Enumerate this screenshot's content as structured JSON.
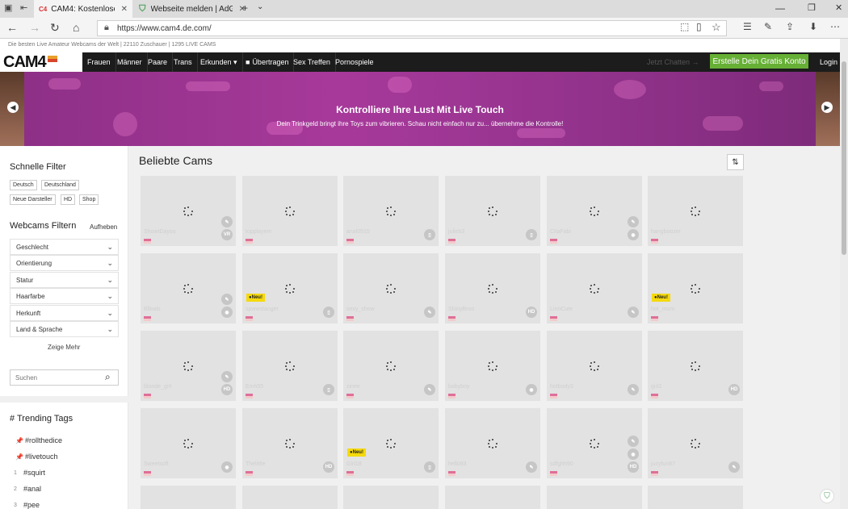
{
  "browser": {
    "tabs": [
      {
        "label": "CAM4: Kostenlose Live S",
        "favicon": "C4"
      },
      {
        "label": "Webseite melden | AdGuard",
        "favicon": "shield"
      }
    ],
    "url": "https://www.cam4.de.com/"
  },
  "site": {
    "topline": "Die besten Live Amateur Webcams der Welt  | 22110  Zuschauer  | 1295  LIVE CAMS",
    "logo": "CAM4",
    "menu": [
      "Frauen",
      "Männer",
      "Paare",
      "Trans",
      "Erkunden ▾",
      "Übertragen",
      "Sex Treffen",
      "Pornospiele"
    ],
    "jetzt": "Jetzt Chatten →",
    "signup": "Erstelle Dein Gratis Konto",
    "login": "Login"
  },
  "banner": {
    "title": "Kontrolliere Ihre Lust Mit Live Touch",
    "subtitle": "Dein Trinkgeld bringt ihre Toys zum vibrieren. Schau nicht einfach nur zu... übernehme die Kontrolle!"
  },
  "sidebar": {
    "quick_title": "Schnelle Filter",
    "chips": [
      "Deutsch",
      "Deutschland",
      "Neue Darsteller",
      "HD",
      "Shop"
    ],
    "filter_title": "Webcams Filtern",
    "clear": "Aufheben",
    "filters": [
      "Geschlecht",
      "Orientierung",
      "Statur",
      "Haarfarbe",
      "Herkunft",
      "Land & Sprache"
    ],
    "more": "Zeige Mehr",
    "search_placeholder": "Suchen",
    "trending_title": "# Trending Tags",
    "tags": [
      {
        "marker": "📌",
        "label": "#rollthedice"
      },
      {
        "marker": "📌",
        "label": "#livetouch"
      },
      {
        "marker": "1",
        "label": "#squirt"
      },
      {
        "marker": "2",
        "label": "#anal"
      },
      {
        "marker": "3",
        "label": "#pee"
      }
    ]
  },
  "main": {
    "title": "Beliebte Cams",
    "neu_label": "●Neu!",
    "cards": [
      {
        "name": "ShowtDayou",
        "badges": [
          "✎",
          "VR"
        ],
        "neu": false
      },
      {
        "name": "topplayern",
        "badges": [],
        "neu": false
      },
      {
        "name": "anal0515",
        "badges": [
          "▯"
        ],
        "neu": false
      },
      {
        "name": "julieb3",
        "badges": [
          "▯"
        ],
        "neu": false
      },
      {
        "name": "CitaFabi",
        "badges": [
          "✎",
          "◉"
        ],
        "neu": false
      },
      {
        "name": "hangboozer",
        "badges": [],
        "neu": false
      },
      {
        "name": "Blloals",
        "badges": [
          "✎",
          "◉"
        ],
        "neu": false
      },
      {
        "name": "spwwstanger",
        "badges": [
          "▯"
        ],
        "neu": true
      },
      {
        "name": "sexy_show",
        "badges": [
          "✎"
        ],
        "neu": false
      },
      {
        "name": "ShinyBroo",
        "badges": [
          "HD"
        ],
        "neu": false
      },
      {
        "name": "LinnCute",
        "badges": [
          "✎"
        ],
        "neu": false
      },
      {
        "name": "hot_mom",
        "badges": [],
        "neu": true
      },
      {
        "name": "blonde_girl",
        "badges": [
          "✎",
          "HD"
        ],
        "neu": false
      },
      {
        "name": "Emh55",
        "badges": [
          "▯"
        ],
        "neu": false
      },
      {
        "name": "zinee",
        "badges": [
          "✎"
        ],
        "neu": false
      },
      {
        "name": "babyboy",
        "badges": [
          "◉"
        ],
        "neu": false
      },
      {
        "name": "hotbody3",
        "badges": [
          "✎"
        ],
        "neu": false
      },
      {
        "name": "girl2",
        "badges": [
          "HD"
        ],
        "neu": false
      },
      {
        "name": "Sweetsoft",
        "badges": [
          "◉"
        ],
        "neu": false
      },
      {
        "name": "Thelittle",
        "badges": [
          "HD"
        ],
        "neu": false
      },
      {
        "name": "Girl18",
        "badges": [
          "▯"
        ],
        "neu": true
      },
      {
        "name": "hello93",
        "badges": [
          "✎"
        ],
        "neu": false
      },
      {
        "name": "sdfghh90",
        "badges": [
          "✎",
          "◉",
          "HD"
        ],
        "neu": false
      },
      {
        "name": "jucyfun87",
        "badges": [
          "✎"
        ],
        "neu": false
      }
    ]
  }
}
